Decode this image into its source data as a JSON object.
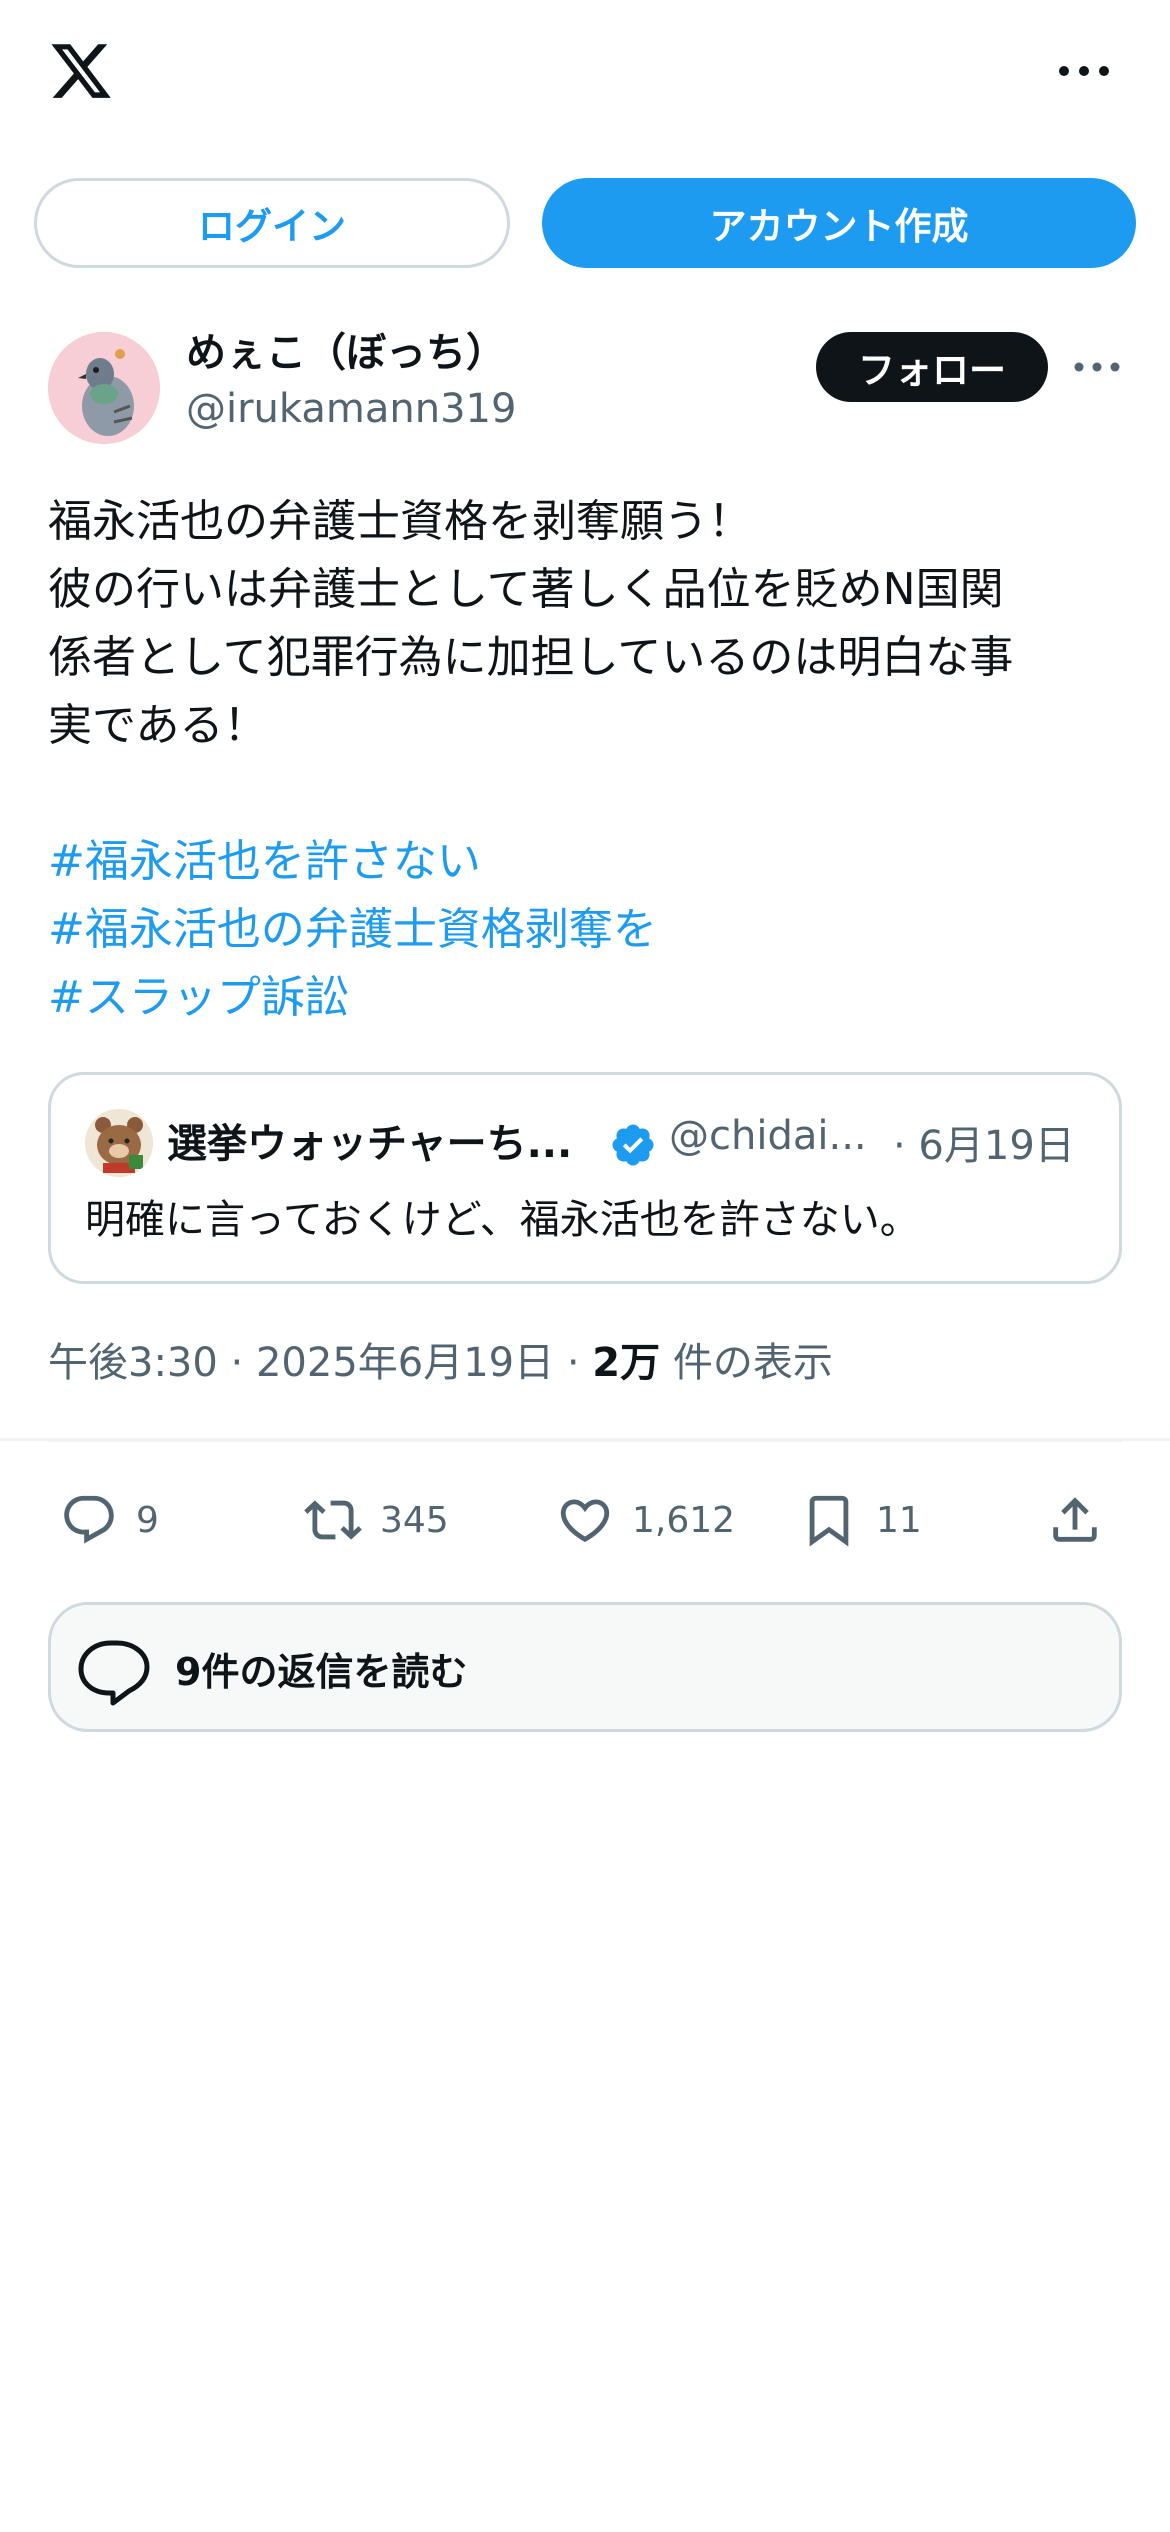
{
  "header": {
    "logo_icon": "x-logo-icon",
    "more_icon": "more-horizontal-icon"
  },
  "auth": {
    "login_label": "ログイン",
    "signup_label": "アカウント作成",
    "accent_color": "#1d9bf0"
  },
  "post": {
    "author": {
      "display_name": "めぇこ（ぼっち）",
      "handle": "@irukamann319",
      "avatar_icon": "pigeon-avatar"
    },
    "follow_label": "フォロー",
    "text_lines": [
      "福永活也の弁護士資格を剥奪願う！",
      "彼の行いは弁護士として著しく品位を貶めN国関",
      "係者として犯罪行為に加担しているのは明白な事",
      "実である！"
    ],
    "hashtags": [
      "#福永活也を許さない",
      "#福永活也の弁護士資格剥奪を",
      "#スラップ訴訟"
    ],
    "quote": {
      "display_name": "選挙ウォッチャーち...",
      "handle": "@chidai...",
      "date": "· 6月19日",
      "text": "明確に言っておくけど、福永活也を許さない。",
      "verified_icon": "verified-badge-icon"
    },
    "meta": {
      "time": "午後3:30 · 2025年6月19日 ·",
      "views_count": "2万",
      "views_label": "件の表示"
    },
    "actions": {
      "replies": "9",
      "reposts": "345",
      "likes": "1,612",
      "bookmarks": "11"
    },
    "read_replies_label": "9件の返信を読む"
  }
}
